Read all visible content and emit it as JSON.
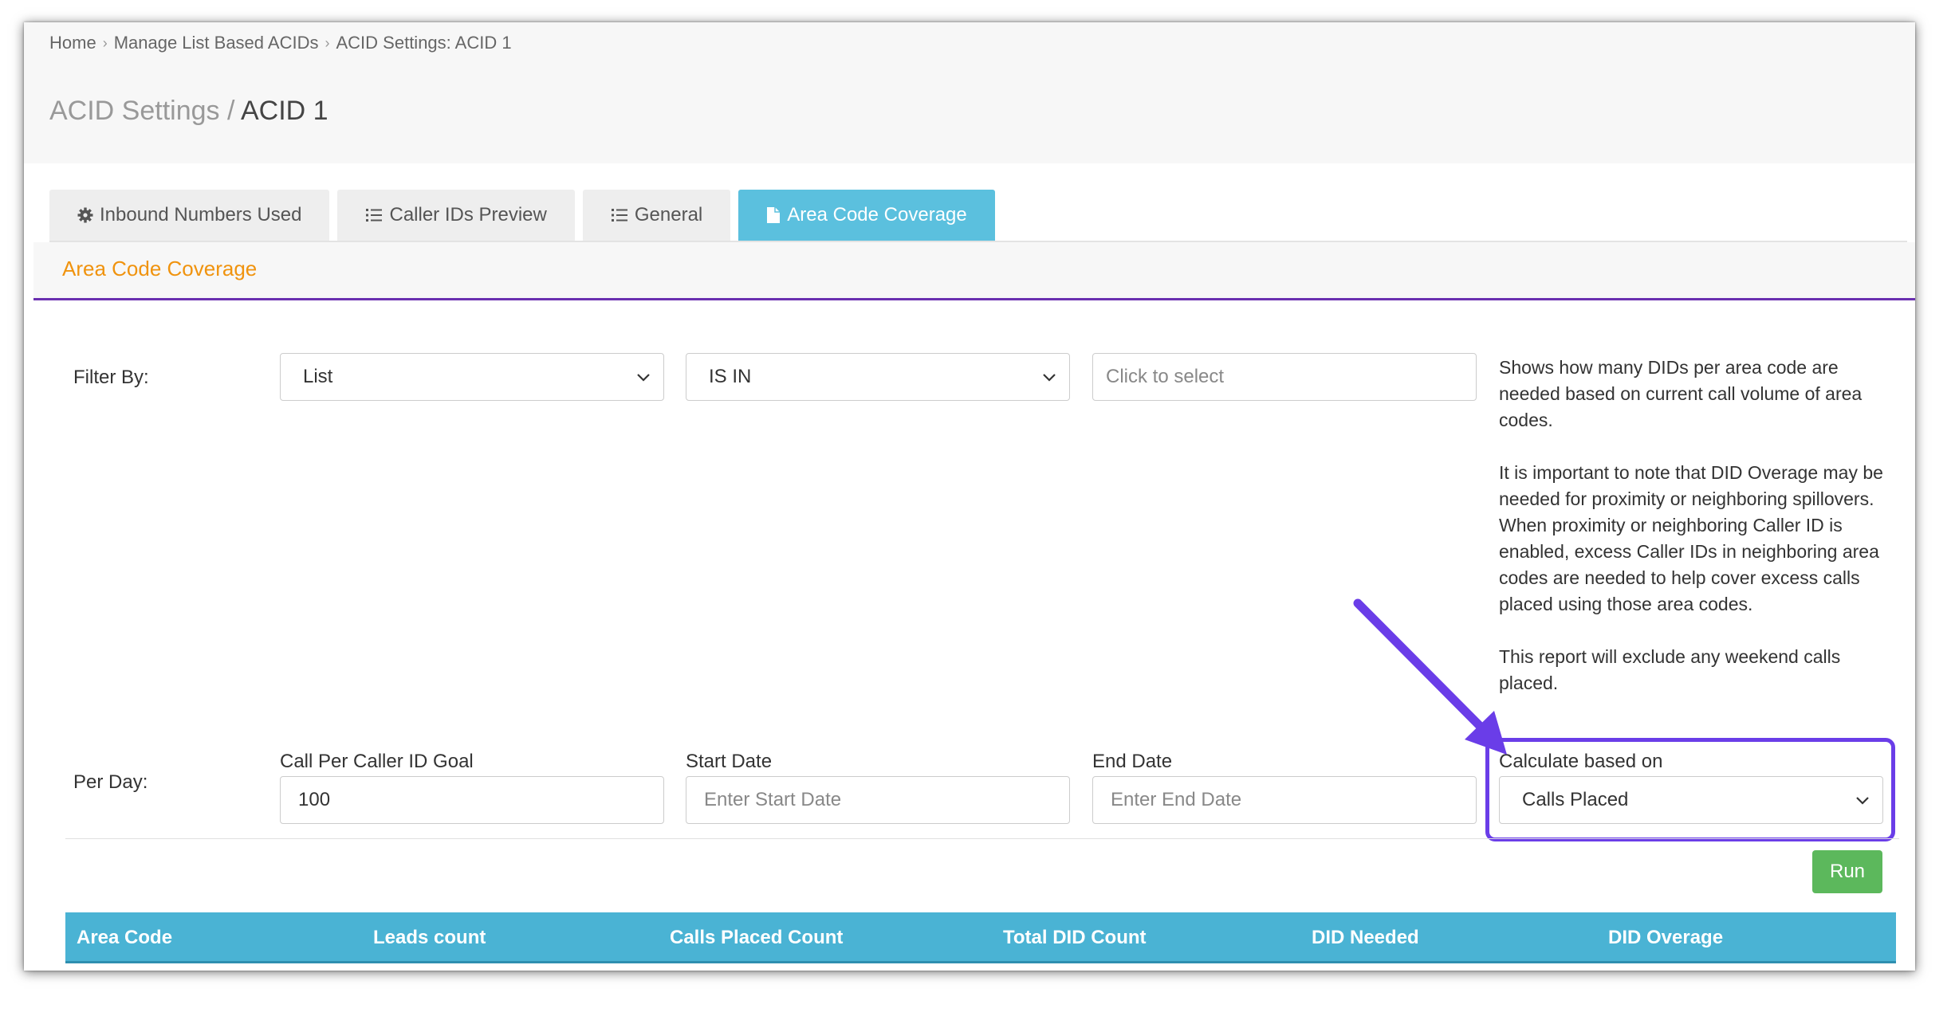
{
  "breadcrumb": {
    "items": [
      "Home",
      "Manage List Based ACIDs",
      "ACID Settings: ACID 1"
    ]
  },
  "page_title": {
    "prefix": "ACID Settings /",
    "current": "ACID 1"
  },
  "tabs": [
    {
      "label": "Inbound Numbers Used",
      "icon": "gear-icon",
      "active": false
    },
    {
      "label": "Caller IDs Preview",
      "icon": "list-icon",
      "active": false
    },
    {
      "label": "General",
      "icon": "list-icon",
      "active": false
    },
    {
      "label": "Area Code Coverage",
      "icon": "file-icon",
      "active": true
    }
  ],
  "section": {
    "title": "Area Code Coverage"
  },
  "filter": {
    "label": "Filter By:",
    "field_value": "List",
    "operator_value": "IS IN",
    "select_placeholder": "Click to select"
  },
  "help": {
    "paragraphs": [
      "Shows how many DIDs per area code are needed based on current call volume of area codes.",
      "It is important to note that DID Overage may be needed for proximity or neighboring spillovers. When proximity or neighboring Caller ID is enabled, excess Caller IDs in neighboring area codes are needed to help cover excess calls placed using those area codes.",
      "This report will exclude any weekend calls placed."
    ]
  },
  "per_day": {
    "label": "Per Day:",
    "goal_label": "Call Per Caller ID Goal",
    "goal_value": "100",
    "start_label": "Start Date",
    "start_placeholder": "Enter Start Date",
    "end_label": "End Date",
    "end_placeholder": "Enter End Date",
    "calc_label": "Calculate based on",
    "calc_value": "Calls Placed"
  },
  "run_label": "Run",
  "table": {
    "headers": [
      "Area Code",
      "Leads count",
      "Calls Placed Count",
      "Total DID Count",
      "DID Needed",
      "DID Overage"
    ]
  },
  "colors": {
    "accent_tab": "#5bc0de",
    "section_title": "#f0930e",
    "section_border": "#6a2fb0",
    "annotation": "#6a3de8",
    "run_button": "#5cb85c",
    "table_header": "#4ab3d4"
  }
}
